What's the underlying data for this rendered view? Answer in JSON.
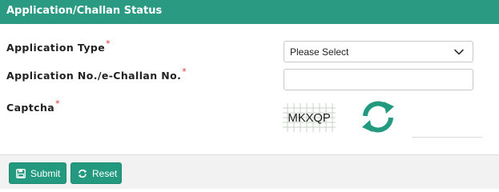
{
  "header": {
    "title": "Application/Challan Status"
  },
  "form": {
    "application_type": {
      "label": "Application Type",
      "required_mark": "*",
      "selected": "Please Select"
    },
    "application_no": {
      "label": "Application No./e-Challan No.",
      "required_mark": "*",
      "value": ""
    },
    "captcha": {
      "label": "Captcha",
      "required_mark": "*",
      "image_text": "MKXQP",
      "input_value": ""
    }
  },
  "buttons": {
    "submit": "Submit",
    "reset": "Reset"
  },
  "colors": {
    "accent": "#2b9a83",
    "required": "#d9342b",
    "footer_bg": "#f2f2f2"
  },
  "icons": {
    "select": "chevron-down-icon",
    "refresh": "refresh-icon",
    "submit": "save-icon",
    "reset": "reset-icon"
  }
}
